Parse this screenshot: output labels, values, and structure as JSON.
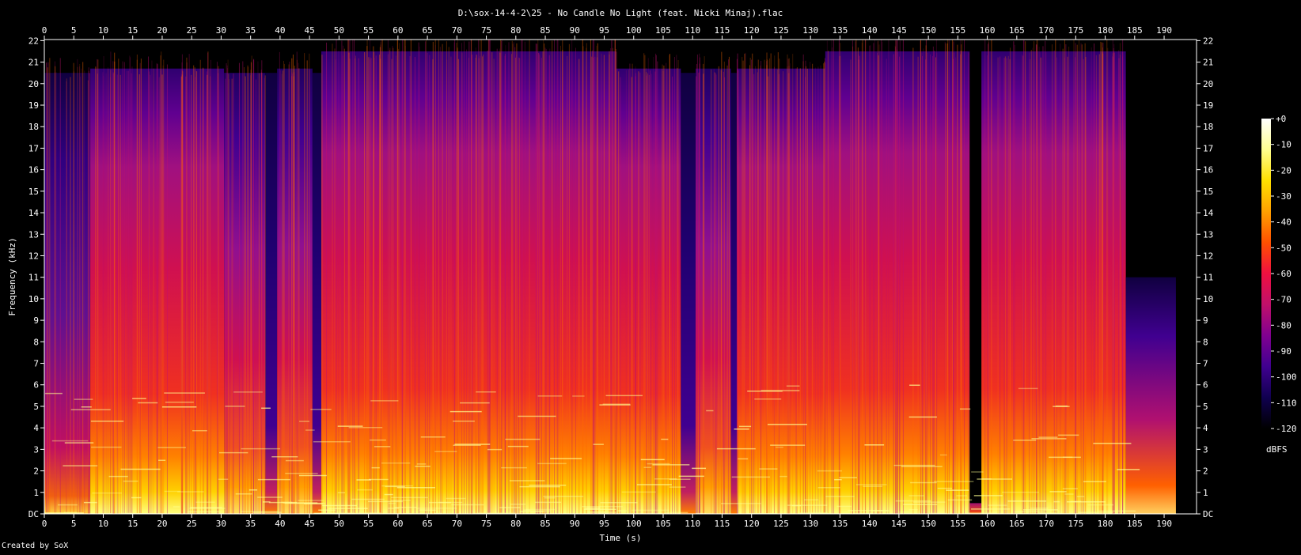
{
  "chart_data": {
    "type": "heatmap",
    "title": "D:\\sox-14-4-2\\25 - No Candle No Light (feat. Nicki Minaj).flac",
    "xlabel": "Time (s)",
    "ylabel": "Frequency (kHz)",
    "xlim": [
      0,
      195.5
    ],
    "ylim": [
      0,
      22.05
    ],
    "x_ticks": [
      "0",
      "5",
      "10",
      "15",
      "20",
      "25",
      "30",
      "35",
      "40",
      "45",
      "50",
      "55",
      "60",
      "65",
      "70",
      "75",
      "80",
      "85",
      "90",
      "95",
      "100",
      "105",
      "110",
      "115",
      "120",
      "125",
      "130",
      "135",
      "140",
      "145",
      "150",
      "155",
      "160",
      "165",
      "170",
      "175",
      "180",
      "185",
      "190"
    ],
    "y_ticks": [
      "DC",
      "1",
      "2",
      "3",
      "4",
      "5",
      "6",
      "7",
      "8",
      "9",
      "10",
      "11",
      "12",
      "13",
      "14",
      "15",
      "16",
      "17",
      "18",
      "19",
      "20",
      "21",
      "22"
    ],
    "colorbar": {
      "label": "dBFS",
      "ticks": [
        "+0",
        "-10",
        "-20",
        "-30",
        "-40",
        "-50",
        "-60",
        "-70",
        "-80",
        "-90",
        "-100",
        "-110",
        "-120"
      ],
      "colors": [
        "#ffffff",
        "#ffff90",
        "#ffe000",
        "#ffa000",
        "#ff5000",
        "#f01040",
        "#c0106a",
        "#800090",
        "#400090",
        "#100050",
        "#000000"
      ]
    },
    "segments": [
      {
        "start": 0.0,
        "end": 7.8,
        "level": "low",
        "cutoff_khz": 20.5
      },
      {
        "start": 7.8,
        "end": 30.5,
        "level": "high",
        "cutoff_khz": 20.7
      },
      {
        "start": 30.5,
        "end": 37.5,
        "level": "mid",
        "cutoff_khz": 20.5
      },
      {
        "start": 37.5,
        "end": 39.5,
        "level": "quiet",
        "cutoff_khz": 20.5
      },
      {
        "start": 39.5,
        "end": 45.5,
        "level": "mid",
        "cutoff_khz": 20.7
      },
      {
        "start": 45.5,
        "end": 47.0,
        "level": "quiet",
        "cutoff_khz": 20.5
      },
      {
        "start": 47.0,
        "end": 97.0,
        "level": "high",
        "cutoff_khz": 21.5
      },
      {
        "start": 97.0,
        "end": 108.0,
        "level": "high",
        "cutoff_khz": 20.7
      },
      {
        "start": 108.0,
        "end": 110.5,
        "level": "quiet",
        "cutoff_khz": 20.5
      },
      {
        "start": 110.5,
        "end": 116.5,
        "level": "mid",
        "cutoff_khz": 20.7
      },
      {
        "start": 116.5,
        "end": 117.5,
        "level": "quiet",
        "cutoff_khz": 20.5
      },
      {
        "start": 117.5,
        "end": 132.5,
        "level": "high",
        "cutoff_khz": 20.7
      },
      {
        "start": 132.5,
        "end": 157.0,
        "level": "high",
        "cutoff_khz": 21.5
      },
      {
        "start": 157.0,
        "end": 159.0,
        "level": "break",
        "cutoff_khz": 0.5
      },
      {
        "start": 159.0,
        "end": 183.5,
        "level": "high",
        "cutoff_khz": 21.5
      },
      {
        "start": 183.5,
        "end": 192.0,
        "level": "fade",
        "cutoff_khz": 11.0
      }
    ]
  },
  "footer": {
    "credit": "Created by SoX"
  }
}
